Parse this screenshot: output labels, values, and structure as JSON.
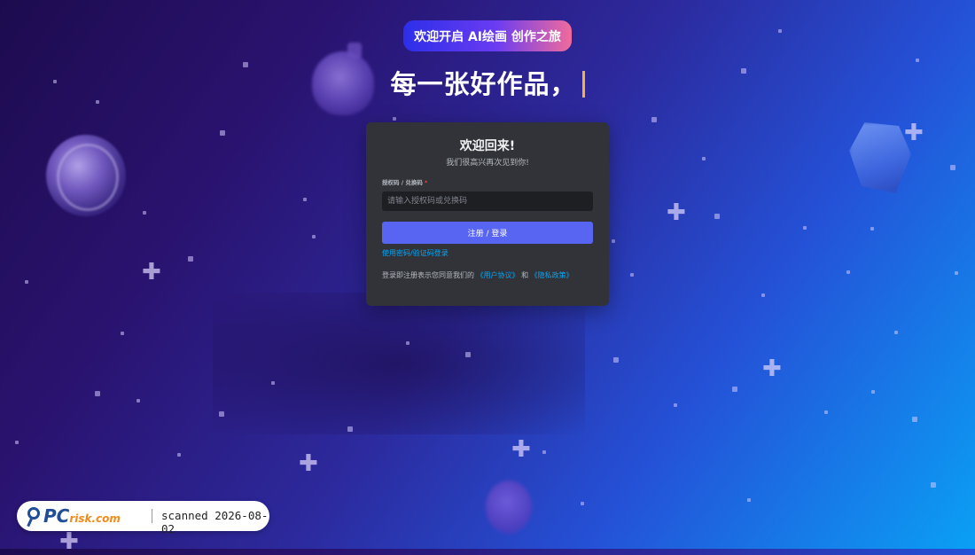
{
  "banner": {
    "text": "欢迎开启 AI绘画 创作之旅"
  },
  "headline": {
    "text": "每一张好作品，"
  },
  "login": {
    "title": "欢迎回来!",
    "subtitle": "我们很高兴再次见到你!",
    "field_label": "授权码 / 兑换码",
    "required_mark": "*",
    "input_value": "",
    "input_placeholder": "请输入授权码或兑换码",
    "submit_label": "注册 / 登录",
    "alt_login_link": "使用密码/验证码登录",
    "terms_prefix": "登录即注册表示您同意我们的",
    "user_agreement": "《用户协议》",
    "terms_and": "和",
    "privacy_policy": "《隐私政策》"
  },
  "watermark": {
    "logo_pc": "PC",
    "logo_risk": "risk.com",
    "scan_text": "scanned 2026-08-02"
  },
  "colors": {
    "accent": "#5865f2",
    "link": "#00a8fc",
    "card_bg": "#313338",
    "input_bg": "#1e1f22",
    "cursor": "#f3b23a"
  }
}
